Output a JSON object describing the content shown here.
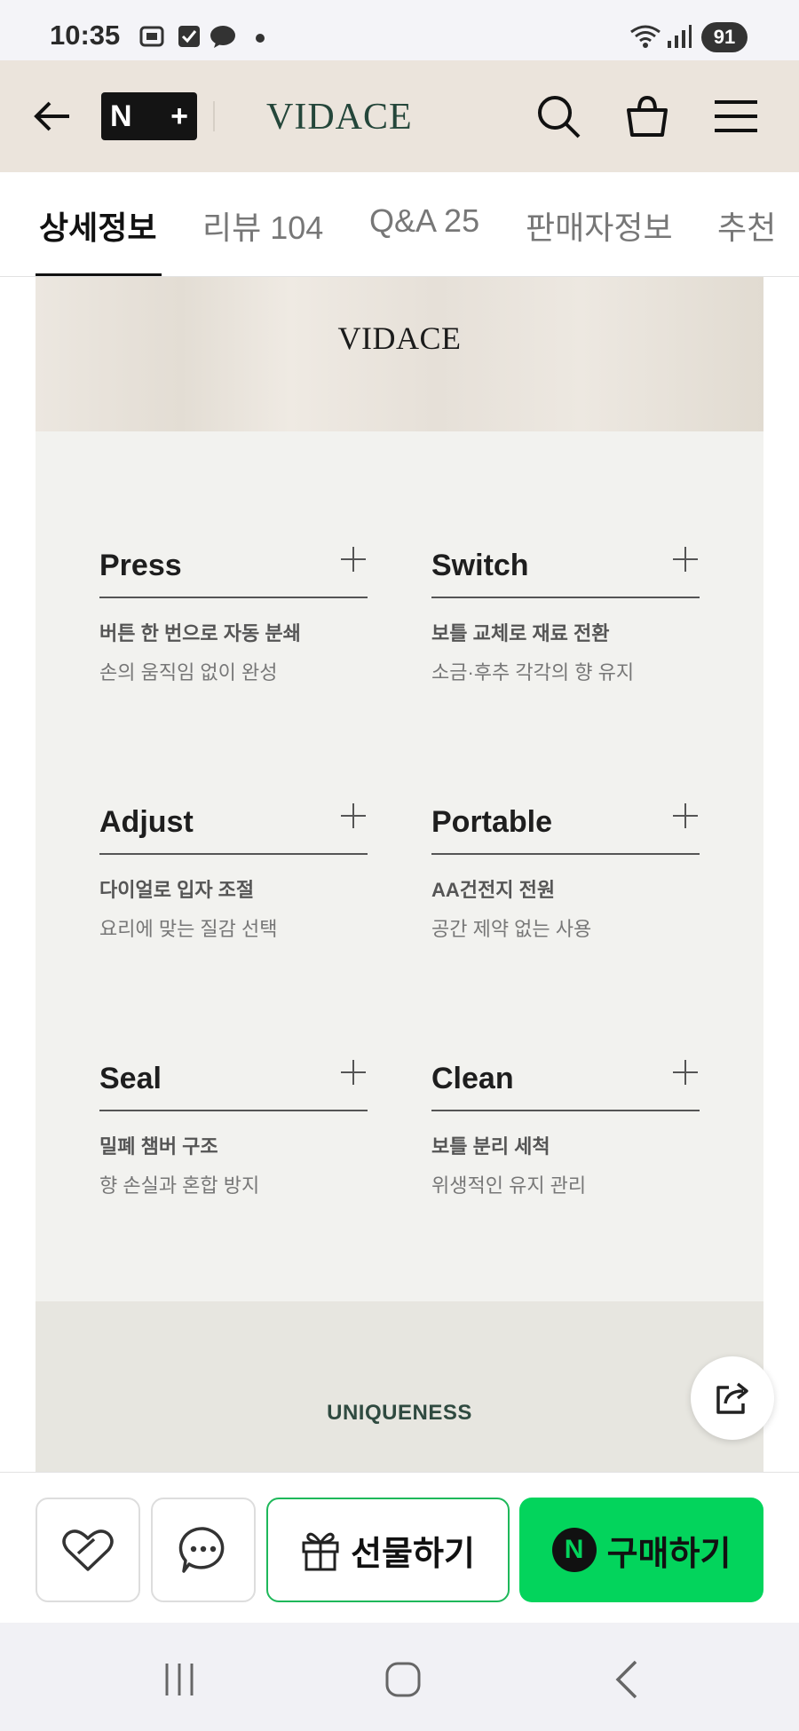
{
  "status_bar": {
    "time": "10:35",
    "battery": "91"
  },
  "header": {
    "np_left": "N",
    "np_right": "+",
    "brand": "VIDACE"
  },
  "tabs": [
    {
      "label": "상세정보"
    },
    {
      "label": "리뷰 104"
    },
    {
      "label": "Q&A 25"
    },
    {
      "label": "판매자정보"
    },
    {
      "label": "추천"
    }
  ],
  "banner": {
    "logo": "VIDACE"
  },
  "features": [
    {
      "title": "Press",
      "line1": "버튼 한 번으로 자동 분쇄",
      "line2": "손의 움직임 없이 완성"
    },
    {
      "title": "Switch",
      "line1": "보틀 교체로 재료 전환",
      "line2": "소금·후추 각각의 향 유지"
    },
    {
      "title": "Adjust",
      "line1": "다이얼로 입자 조절",
      "line2": "요리에 맞는 질감 선택"
    },
    {
      "title": "Portable",
      "line1": "AA건전지 전원",
      "line2": "공간 제약 없는 사용"
    },
    {
      "title": "Seal",
      "line1": "밀폐 챔버 구조",
      "line2": "향 손실과 혼합 방지"
    },
    {
      "title": "Clean",
      "line1": "보틀 분리 세척",
      "line2": "위생적인 유지 관리"
    }
  ],
  "uniqueness": {
    "title": "UNIQUENESS"
  },
  "actions": {
    "gift_label": "선물하기",
    "buy_label": "구매하기",
    "buy_badge": "N"
  },
  "colors": {
    "header_bg": "#ebe4dc",
    "brand_green": "#24463a",
    "buy_green": "#03d45c",
    "gift_border": "#1eb85a"
  }
}
